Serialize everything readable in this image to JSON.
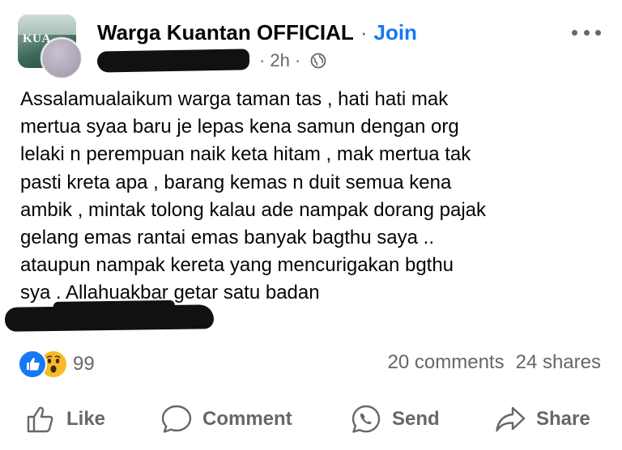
{
  "post": {
    "group_logo_text": "KUA",
    "group_name": "Warga Kuantan OFFICIAL",
    "separator": "·",
    "join_label": "Join",
    "time": "2h",
    "body_lines": [
      "Assalamualaikum warga taman tas , hati hati mak",
      "mertua syaa baru je lepas kena samun dengan org",
      "lelaki n perempuan naik keta hitam , mak mertua tak",
      "pasti kreta apa , barang kemas n duit semua kena",
      "ambik , mintak tolong kalau ade nampak dorang pajak",
      "gelang emas rantai emas banyak bagthu saya ..",
      "ataupun nampak kereta yang mencurigakan bgthu",
      "sya . Allahuakbar getar satu badan"
    ]
  },
  "engagement": {
    "reaction_count": "99",
    "comments": "20 comments",
    "shares": "24 shares"
  },
  "actions": {
    "like": "Like",
    "comment": "Comment",
    "send": "Send",
    "share": "Share"
  },
  "colors": {
    "link_blue": "#1877f2",
    "secondary_text": "#65676b",
    "wow_yellow": "#f7b928"
  },
  "icons": [
    "more-options-icon",
    "globe-icon",
    "like-reaction-icon",
    "wow-reaction-icon",
    "thumbs-up-icon",
    "comment-bubble-icon",
    "whatsapp-icon",
    "share-arrow-icon"
  ]
}
